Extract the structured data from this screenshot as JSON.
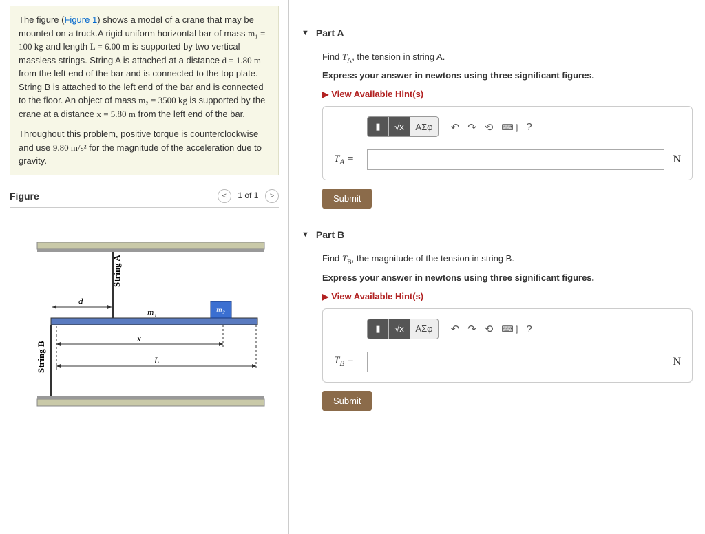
{
  "problem": {
    "text_pre": "The figure (",
    "fig_link": "Figure 1",
    "text_post": ") shows a model of a crane that may be mounted on a truck.A rigid uniform horizontal bar of mass ",
    "m1": "m₁ = 100 kg",
    "t2": " and length ",
    "L": "L = 6.00 m",
    "t3": " is supported by two vertical massless strings. String A is attached at a distance ",
    "d": "d = 1.80 m",
    "t4": " from the left end of the bar and is connected to the top plate. String B is attached to the left end of the bar and is connected to the floor. An object of mass ",
    "m2": "m₂ = 3500 kg",
    "t5": " is supported by the crane at a distance ",
    "x": "x = 5.80 m",
    "t6": " from the left end of the bar.",
    "para2_a": "Throughout this problem, positive torque is counterclockwise and use ",
    "g": "9.80 m/s²",
    "para2_b": " for the magnitude of the acceleration due to gravity."
  },
  "figure": {
    "heading": "Figure",
    "nav_label": "1 of 1",
    "labels": {
      "stringA": "String A",
      "stringB": "String B",
      "d": "d",
      "m1": "m₁",
      "m2": "m₂",
      "x": "x",
      "L": "L"
    }
  },
  "answer_toolbar": {
    "fraction": "▮",
    "sqrt": "√x",
    "greek": "ΑΣφ",
    "undo": "↶",
    "redo": "↷",
    "reset": "⟲",
    "keyboard": "⌨ ]",
    "help": "?"
  },
  "partA": {
    "title": "Part A",
    "prompt_pre": "Find ",
    "var": "T",
    "sub": "A",
    "prompt_post": ", the tension in string A.",
    "express": "Express your answer in newtons using three significant figures.",
    "hints": "View Available Hint(s)",
    "answer_label": "Tᴀ =",
    "unit": "N",
    "submit": "Submit"
  },
  "partB": {
    "title": "Part B",
    "prompt_pre": "Find ",
    "var": "T",
    "sub": "B",
    "prompt_post": ", the magnitude of the tension in string B.",
    "express": "Express your answer in newtons using three significant figures.",
    "hints": "View Available Hint(s)",
    "answer_label": "Tʙ =",
    "unit": "N",
    "submit": "Submit"
  }
}
